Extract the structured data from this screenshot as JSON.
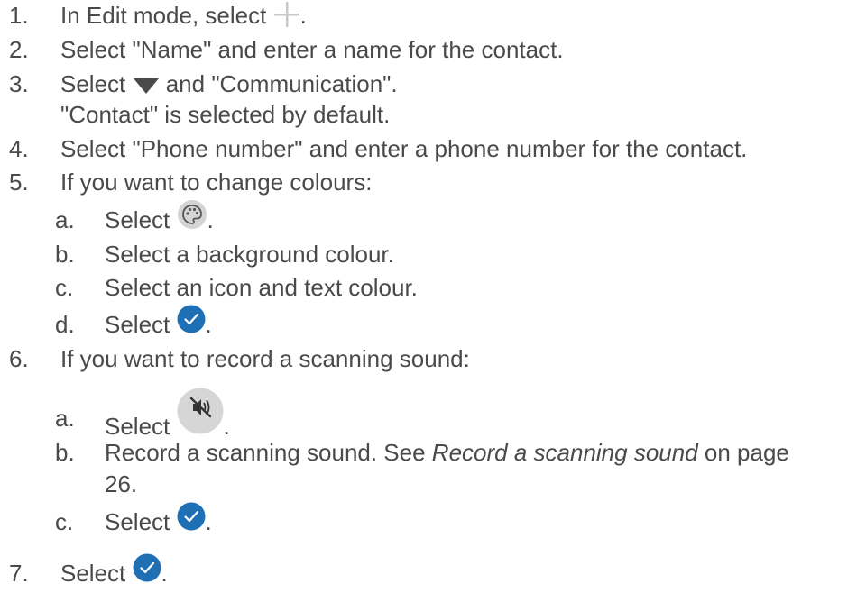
{
  "steps": [
    {
      "num": "1.",
      "pre": "In Edit mode, select ",
      "post": "."
    },
    {
      "num": "2.",
      "text": "Select \"Name\" and enter a name for the contact."
    },
    {
      "num": "3.",
      "pre": "Select ",
      "post": " and \"Communication\".",
      "note": "\"Contact\" is selected by default."
    },
    {
      "num": "4.",
      "text": "Select \"Phone number\" and enter a phone number for the contact."
    },
    {
      "num": "5.",
      "text": "If you want to change colours:",
      "substeps": [
        {
          "letter": "a.",
          "pre": "Select ",
          "post": "."
        },
        {
          "letter": "b.",
          "text": "Select a background colour."
        },
        {
          "letter": "c.",
          "text": "Select an icon and text colour."
        },
        {
          "letter": "d.",
          "pre": "Select ",
          "post": "."
        }
      ]
    },
    {
      "num": "6.",
      "text": "If you want to record a scanning sound:",
      "substeps": [
        {
          "letter": "a.",
          "pre": "Select ",
          "post": "."
        },
        {
          "letter": "b.",
          "pre": "Record a scanning sound. See ",
          "ref": "Record a scanning sound",
          "post": " on page",
          "post2": "26."
        },
        {
          "letter": "c.",
          "pre": "Select ",
          "post": "."
        }
      ]
    },
    {
      "num": "7.",
      "pre": "Select ",
      "post": "."
    }
  ],
  "icons": {
    "add": "plus-icon",
    "dropdown": "triangle-down-icon",
    "palette": "palette-icon",
    "confirm": "checkmark-circle-icon",
    "sound": "speaker-muted-icon"
  },
  "colors": {
    "text": "#4a4a4a",
    "confirm_blue": "#1f6fb5",
    "icon_gray": "#cfcfcf"
  }
}
